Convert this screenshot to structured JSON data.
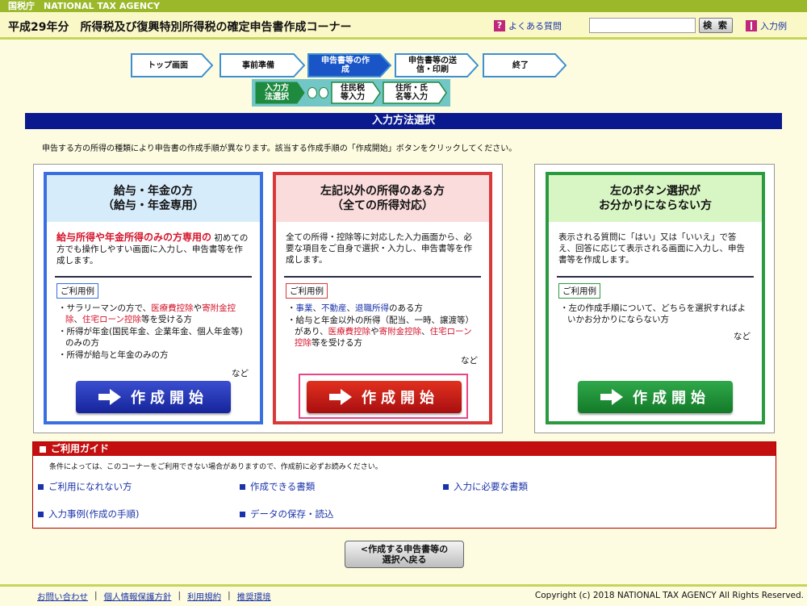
{
  "topbar": {
    "label": "国税庁　NATIONAL TAX AGENCY"
  },
  "header": {
    "title": "平成29年分　所得税及び復興特別所得税の確定申告書作成コーナー",
    "faq": "よくある質問",
    "search_button": "検 索",
    "search_placeholder": "",
    "input_example": "入力例"
  },
  "steps": [
    {
      "label": "トップ画面",
      "active": false
    },
    {
      "label": "事前準備",
      "active": false
    },
    {
      "label": "申告書等の作成",
      "active": true
    },
    {
      "label": "申告書等の送信・印刷",
      "active": false
    },
    {
      "label": "終了",
      "active": false
    }
  ],
  "substeps": [
    {
      "label": "入力方法選択",
      "active": true
    },
    {
      "label": "住民税等入力",
      "active": false
    },
    {
      "label": "住所・氏名等入力",
      "active": false
    }
  ],
  "section_title": "入力方法選択",
  "instruction": "申告する方の所得の種類により申告書の作成手順が異なります。該当する作成手順の「作成開始」ボタンをクリックしてください。",
  "cards": {
    "salary": {
      "title1": "給与・年金の方",
      "title2": "（給与・年金専用）",
      "desc_red": "給与所得や年金所得のみの方専用の",
      "desc": "初めての方でも操作しやすい画面に入力し、申告書等を作成します。",
      "usage_label": "ご利用例",
      "items": [
        {
          "pre": "・サラリーマンの方で、",
          "r1": "医療費控除",
          "mid": "や",
          "r2": "寄附金控除",
          "sep": "、",
          "r3": "住宅ローン控除",
          "post": "等を受ける方"
        },
        {
          "text": "・所得が年金(国民年金、企業年金、個人年金等)のみの方"
        },
        {
          "text": "・所得が給与と年金のみの方"
        }
      ],
      "nado": "など",
      "button": "作成開始"
    },
    "other": {
      "title1": "左記以外の所得のある方",
      "title2": "（全ての所得対応）",
      "desc": "全ての所得・控除等に対応した入力画面から、必要な項目をご自身で選択・入力し、申告書等を作成します。",
      "usage_label": "ご利用例",
      "item1": {
        "pre": "・",
        "b1": "事業",
        "s1": "、",
        "b2": "不動産",
        "s2": "、",
        "b3": "退職所得",
        "post": "のある方"
      },
      "item2": {
        "pre": "・給与と年金以外の所得（配当、一時、譲渡等）があり、",
        "r1": "医療費控除",
        "mid": "や",
        "r2": "寄附金控除",
        "sep": "、",
        "r3": "住宅ローン控除",
        "post": "等を受ける方"
      },
      "nado": "など",
      "button": "作成開始"
    },
    "unsure": {
      "title1": "左のボタン選択が",
      "title2": "お分かりにならない方",
      "desc": "表示される質問に「はい」又は「いいえ」で答え、回答に応じて表示される画面に入力し、申告書等を作成します。",
      "usage_label": "ご利用例",
      "item": "・左の作成手順について、どちらを選択すればよいかお分かりにならない方",
      "nado": "など",
      "button": "作成開始"
    }
  },
  "guide": {
    "title": "ご利用ガイド",
    "note": "条件によっては、このコーナーをご利用できない場合がありますので、作成前に必ずお読みください。",
    "links": [
      "ご利用になれない方",
      "作成できる書類",
      "入力に必要な書類",
      "入力事例(作成の手順)",
      "データの保存・読込"
    ]
  },
  "back_button": {
    "line1": "<作成する申告書等の",
    "line2": "選択へ戻る"
  },
  "footer": {
    "links": [
      "お問い合わせ",
      "個人情報保護方針",
      "利用規約",
      "推奨環境"
    ],
    "separator": "|",
    "copyright": "Copyright (c) 2018 NATIONAL TAX AGENCY All Rights Reserved."
  },
  "colors": {
    "navy": "#0a1a8e",
    "salary": "#3a6fe0",
    "other": "#d83a3a",
    "unsure": "#2a9a3e",
    "guide": "#c40f10",
    "topbar": "#9bb82a"
  }
}
